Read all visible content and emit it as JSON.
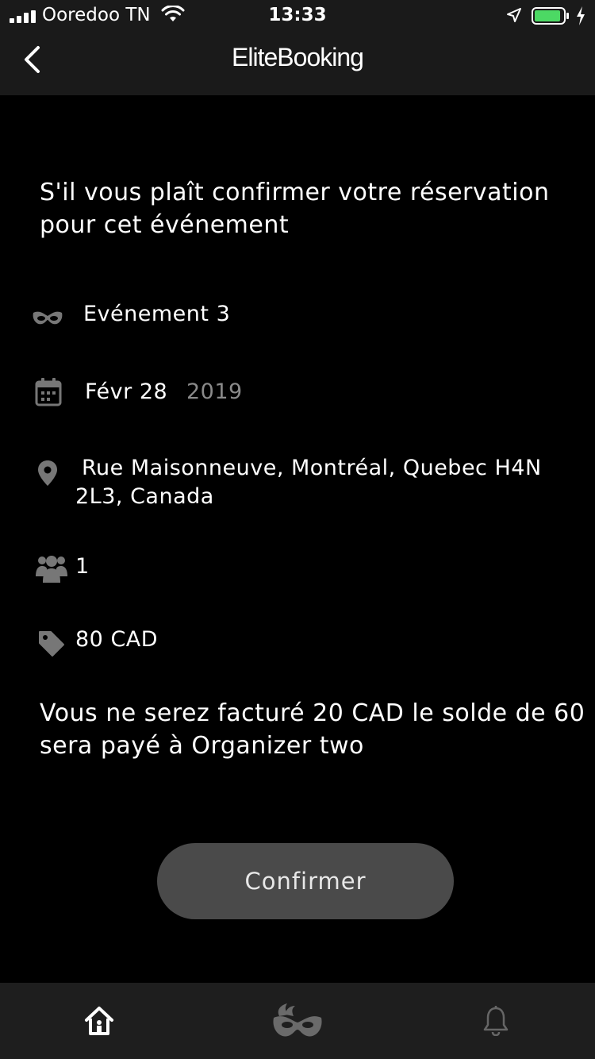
{
  "status_bar": {
    "carrier": "Ooredoo TN",
    "time": "13:33",
    "battery_color": "#4cd964"
  },
  "nav": {
    "brand": "EliteBooking",
    "back_icon": "chevron-left-icon"
  },
  "content": {
    "intro": "S'il vous plaît confirmer votre réservation pour cet événement",
    "event_name": "Evénement 3",
    "date_day": "Févr 28",
    "date_year": "2019",
    "address_line1": "Rue Maisonneuve, Montréal, Quebec H4N",
    "address_line2": "2L3, Canada",
    "guests": "1",
    "price": "80 CAD",
    "notice": "Vous ne serez facturé 20 CAD le solde de 60 sera payé à Organizer two"
  },
  "actions": {
    "confirm_label": "Confirmer"
  },
  "tab_bar": {
    "items": [
      {
        "icon": "home-icon",
        "active": true
      },
      {
        "icon": "mask-icon",
        "active": false
      },
      {
        "icon": "bell-icon",
        "active": false
      }
    ]
  },
  "colors": {
    "background": "#000000",
    "header": "#1a1a1a",
    "button": "#4a4a4a",
    "muted_text": "#8a8a8a"
  }
}
